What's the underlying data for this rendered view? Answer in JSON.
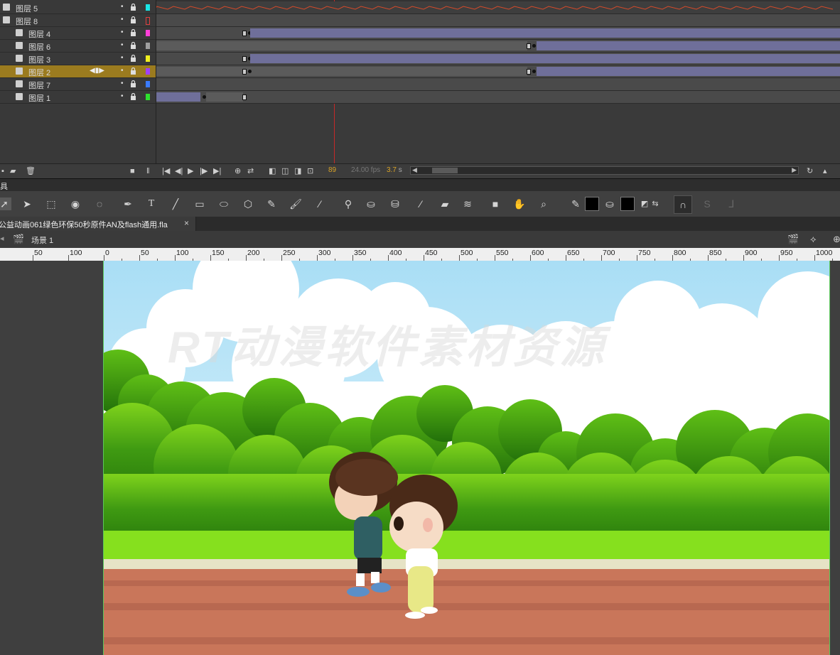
{
  "timeline": {
    "layers": [
      {
        "name": "图层 5",
        "color": "#19e6e6",
        "type": "audio"
      },
      {
        "name": "图层 8",
        "color": "#e04040",
        "type": "folder"
      },
      {
        "name": "图层 4",
        "color": "#ff3fd8",
        "type": "layer"
      },
      {
        "name": "图层 6",
        "color": "#a0a0a0",
        "type": "layer"
      },
      {
        "name": "图层 3",
        "color": "#f0f020",
        "type": "layer"
      },
      {
        "name": "图层 2",
        "color": "#a040ff",
        "type": "layer",
        "selected": true
      },
      {
        "name": "图层 7",
        "color": "#3a7bff",
        "type": "layer"
      },
      {
        "name": "图层 1",
        "color": "#2ee02e",
        "type": "layer"
      }
    ],
    "current_frame": "89",
    "fps": "24.00 fps",
    "elapsed": "3.7",
    "elapsed_unit": "s"
  },
  "tools_panel": {
    "title": "具"
  },
  "document": {
    "tab_label": "公益动画061绿色环保50秒原件AN及flash通用.fla",
    "tab_close": "×",
    "scene_label": "场景 1"
  },
  "ruler": {
    "left_labels": [
      "50",
      "100"
    ],
    "labels": [
      "0",
      "50",
      "100",
      "150",
      "200",
      "250",
      "300",
      "350",
      "400",
      "450",
      "500",
      "550",
      "600",
      "650",
      "700",
      "750",
      "800",
      "850",
      "900",
      "950",
      "1000"
    ]
  },
  "stage": {
    "watermark": "RT动漫软件素材资源",
    "colors": {
      "sky": "#b6e3f6",
      "grass": "#86e01e",
      "track": "#c9765a",
      "stage_border": "#5ac85a"
    }
  }
}
